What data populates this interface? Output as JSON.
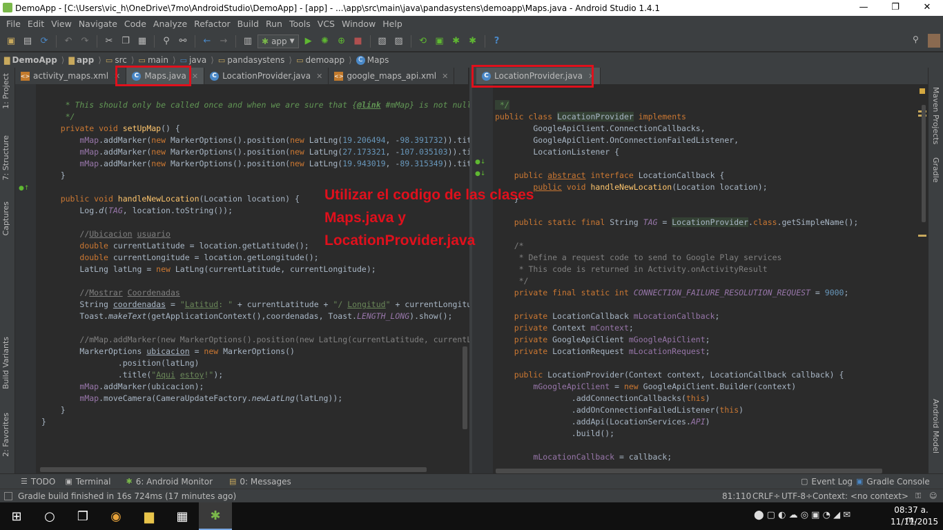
{
  "window": {
    "title": "DemoApp - [C:\\Users\\vic_h\\OneDrive\\7mo\\AndroidStudio\\DemoApp] - [app] - ...\\app\\src\\main\\java\\pandasystens\\demoapp\\Maps.java - Android Studio 1.4.1",
    "minimize": "—",
    "maximize": "❐",
    "close": "✕"
  },
  "menu": [
    "File",
    "Edit",
    "View",
    "Navigate",
    "Code",
    "Analyze",
    "Refactor",
    "Build",
    "Run",
    "Tools",
    "VCS",
    "Window",
    "Help"
  ],
  "toolbar": {
    "run_config": "app"
  },
  "breadcrumbs": [
    "DemoApp",
    "app",
    "src",
    "main",
    "java",
    "pandasystens",
    "demoapp",
    "Maps"
  ],
  "tabs_left": [
    {
      "label": "activity_maps.xml",
      "kind": "xml"
    },
    {
      "label": "Maps.java",
      "kind": "java",
      "active": true
    },
    {
      "label": "LocationProvider.java",
      "kind": "java"
    },
    {
      "label": "google_maps_api.xml",
      "kind": "xml"
    }
  ],
  "tabs_right": [
    {
      "label": "LocationProvider.java",
      "kind": "java",
      "active": true
    }
  ],
  "left_tool_tabs": [
    "1: Project",
    "7: Structure",
    "Captures",
    "Build Variants",
    "2: Favorites"
  ],
  "right_tool_tabs": [
    "Maven Projects",
    "Gradle",
    "Android Model"
  ],
  "overlay_text": "Utilizar el codigo de las clases\nMaps.java y\nLocationProvider.java",
  "bottom_tabs_left": [
    {
      "icon": "todo-icon",
      "label": "TODO"
    },
    {
      "icon": "terminal-icon",
      "label": "Terminal"
    },
    {
      "icon": "android-icon",
      "label": "6: Android Monitor"
    },
    {
      "icon": "messages-icon",
      "label": "0: Messages"
    }
  ],
  "bottom_tabs_right": [
    {
      "icon": "event-log-icon",
      "label": "Event Log"
    },
    {
      "icon": "gradle-console-icon",
      "label": "Gradle Console"
    }
  ],
  "status": {
    "message": "Gradle build finished in 16s 724ms (17 minutes ago)",
    "position": "81:110",
    "line_sep": "CRLF÷",
    "encoding": "UTF-8÷",
    "context": "Context: <no context>"
  },
  "taskbar": {
    "time": "08:37 a. m.",
    "date": "11/11/2015"
  }
}
